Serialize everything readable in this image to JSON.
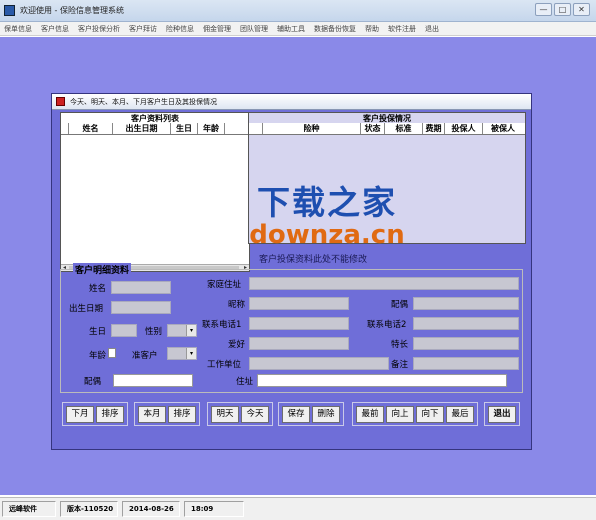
{
  "window": {
    "title": "欢迎使用 - 保险信息管理系统",
    "controls": [
      "—",
      "□",
      "✕"
    ]
  },
  "menu": [
    "保单信息",
    "客户信息",
    "客户投保分析",
    "客户拜访",
    "险种信息",
    "佣金管理",
    "团队管理",
    "辅助工具",
    "数据备份恢复",
    "帮助",
    "软件注册",
    "退出"
  ],
  "dialog": {
    "title": "今天、明天、本月、下月客户生日及其投保情况",
    "customer_list": {
      "caption": "客户资料列表",
      "columns": [
        "姓名",
        "出生日期",
        "生日",
        "年龄"
      ]
    },
    "policy_list": {
      "caption": "客户投保情况",
      "columns": [
        "险种",
        "状态",
        "标准",
        "费期",
        "投保人",
        "被保人"
      ]
    },
    "notice": "客户投保资料此处不能修改",
    "detail": {
      "title": "客户明细资料",
      "labels": {
        "name": "姓名",
        "birthdate": "出生日期",
        "birthday": "生日",
        "gender": "性别",
        "age": "年龄",
        "prospect": "准客户",
        "spouse": "配偶",
        "home_address": "家庭住址",
        "nickname": "昵称",
        "spouse_right": "配偶",
        "phone1": "联系电话1",
        "phone2": "联系电话2",
        "hobby": "爱好",
        "specialty": "特长",
        "workplace": "工作单位",
        "remark": "备注",
        "address": "住址"
      }
    },
    "buttons": {
      "group1": [
        "下月",
        "排序"
      ],
      "group2": [
        "本月",
        "排序"
      ],
      "group3": [
        "明天",
        "今天"
      ],
      "group4": [
        "保存",
        "删除"
      ],
      "group5": [
        "最前",
        "向上",
        "向下",
        "最后"
      ],
      "exit": "退出"
    }
  },
  "statusbar": [
    "远峰软件",
    "版本-110520",
    "2014-08-26",
    "18:09"
  ],
  "watermark": {
    "line1": "下载之家",
    "line2": "downza.cn"
  },
  "colors": {
    "desktop": "#8a89e8",
    "dialog": "#6f6ed8",
    "field": "#c7c7d1",
    "policy_panel": "#d6d5ef"
  }
}
